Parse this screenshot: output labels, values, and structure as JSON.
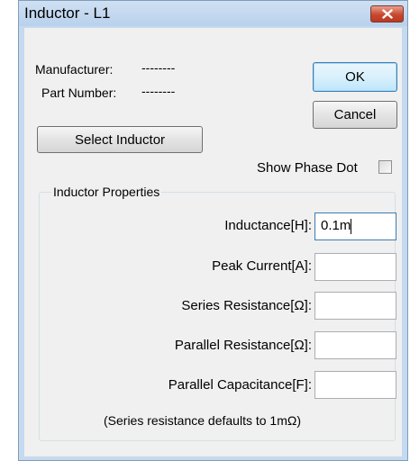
{
  "window": {
    "title": "Inductor - L1"
  },
  "header": {
    "manufacturer_label": "Manufacturer:",
    "manufacturer_value": "--------",
    "part_number_label": "Part Number:",
    "part_number_value": "--------"
  },
  "buttons": {
    "ok_label": "OK",
    "cancel_label": "Cancel",
    "select_inductor_label": "Select Inductor"
  },
  "phase_dot": {
    "label": "Show Phase Dot",
    "checked": false
  },
  "properties": {
    "group_title": "Inductor Properties",
    "fields": [
      {
        "label": "Inductance[H]:",
        "value": "0.1m"
      },
      {
        "label": "Peak Current[A]:",
        "value": ""
      },
      {
        "label": "Series Resistance[Ω]:",
        "value": ""
      },
      {
        "label": "Parallel Resistance[Ω]:",
        "value": ""
      },
      {
        "label": "Parallel Capacitance[F]:",
        "value": ""
      }
    ],
    "note": "(Series resistance defaults to 1mΩ)"
  },
  "colors": {
    "title_bar": "#c5d9ef",
    "close_button": "#c8482f",
    "dialog_background": "#f0f0f0"
  },
  "icons": {
    "close": "close-icon"
  }
}
